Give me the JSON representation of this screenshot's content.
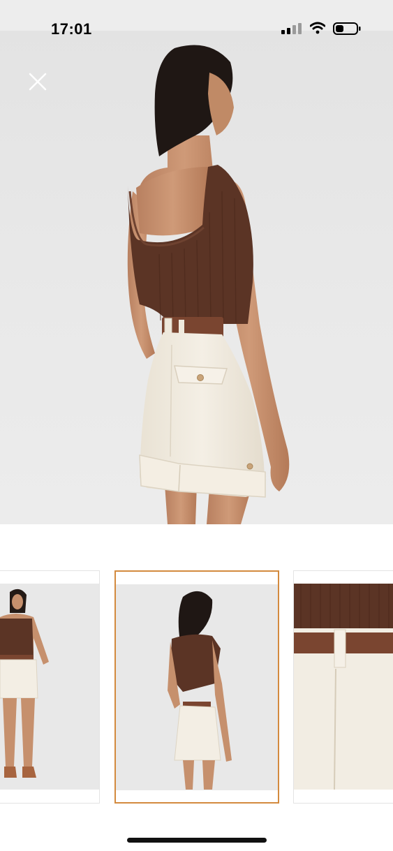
{
  "status_bar": {
    "time": "17:01",
    "icons": [
      "cellular-signal-icon",
      "wifi-icon",
      "battery-icon"
    ]
  },
  "viewer": {
    "close_icon": "close-icon",
    "main_image": "model-back-view-brown-tank-cream-shorts",
    "selected_thumbnail_index": 1
  },
  "thumbnails": [
    {
      "image": "model-front-view"
    },
    {
      "image": "model-back-view"
    },
    {
      "image": "waist-belt-detail"
    }
  ],
  "colors": {
    "selected_border": "#d38a3e",
    "top": "#5b3425",
    "shorts": "#f1ebdf",
    "belt": "#7a4530",
    "skin": "#c6906d"
  }
}
